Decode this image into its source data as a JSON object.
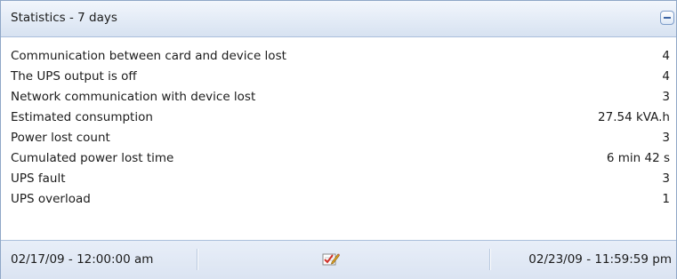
{
  "header": {
    "title": "Statistics - 7 days",
    "collapse_icon": "collapse-minus-icon"
  },
  "stats": [
    {
      "label": "Communication between card and device lost",
      "value": "4"
    },
    {
      "label": "The UPS output is off",
      "value": "4"
    },
    {
      "label": "Network communication with device lost",
      "value": "3"
    },
    {
      "label": "Estimated consumption",
      "value": "27.54 kVA.h"
    },
    {
      "label": "Power lost count",
      "value": "3"
    },
    {
      "label": "Cumulated power lost time",
      "value": "6 min 42 s"
    },
    {
      "label": "UPS fault",
      "value": "3"
    },
    {
      "label": "UPS overload",
      "value": "1"
    }
  ],
  "footer": {
    "start_date": "02/17/09 - 12:00:00 am",
    "end_date": "02/23/09 - 11:59:59 pm",
    "edit_icon": "edit-date-range-icon"
  },
  "colors": {
    "header_bg": "#e3ebf6",
    "border": "#8fa7c7",
    "text": "#1b1b1b",
    "accent": "#3c64a3"
  }
}
